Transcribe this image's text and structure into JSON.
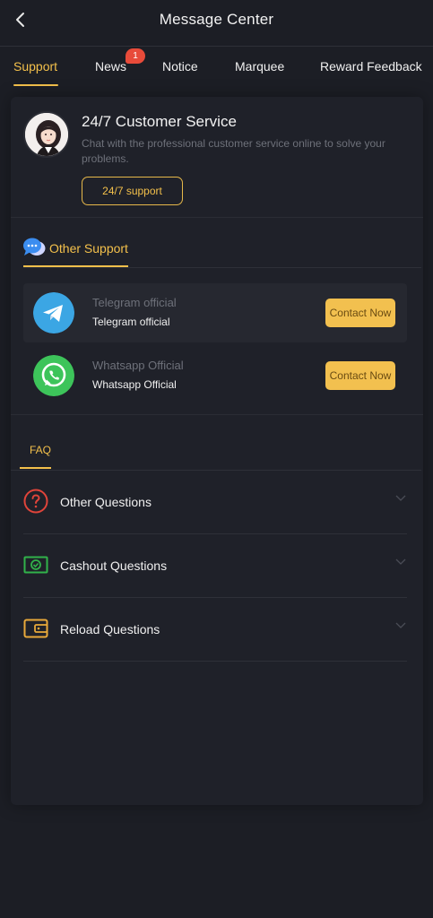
{
  "header": {
    "title": "Message Center",
    "back_icon": "chevron-left-icon"
  },
  "tabs": [
    {
      "label": "Support",
      "active": true
    },
    {
      "label": "News",
      "badge": "1"
    },
    {
      "label": "Notice"
    },
    {
      "label": "Marquee"
    },
    {
      "label": "Reward Feedback"
    }
  ],
  "customer_service": {
    "title": "24/7 Customer Service",
    "description": "Chat with the professional customer service online to solve your problems.",
    "button_label": "24/7 support"
  },
  "other_support": {
    "tab_label": "Other Support",
    "contacts": [
      {
        "name_dim": "Telegram official",
        "name": "Telegram official",
        "button_label": "Contact Now",
        "icon": "telegram-icon"
      },
      {
        "name_dim": "Whatsapp Official",
        "name": "Whatsapp Official",
        "button_label": "Contact Now",
        "icon": "whatsapp-icon"
      }
    ]
  },
  "faq": {
    "tab_label": "FAQ",
    "items": [
      {
        "label": "Other Questions",
        "icon": "question-circle-icon"
      },
      {
        "label": "Cashout Questions",
        "icon": "cash-icon"
      },
      {
        "label": "Reload Questions",
        "icon": "wallet-icon"
      }
    ]
  },
  "colors": {
    "accent": "#f3c04b",
    "background": "#1c1e25",
    "badge": "#e84b3a"
  }
}
